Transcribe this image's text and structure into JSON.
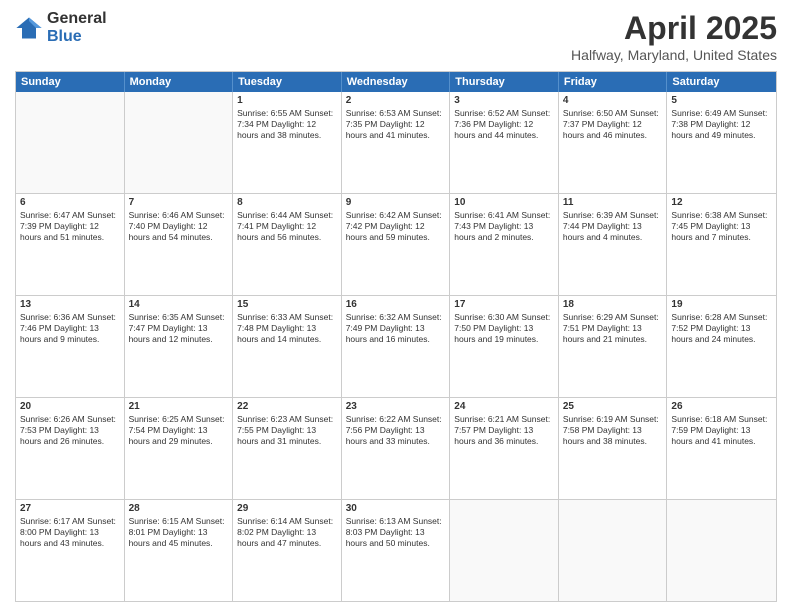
{
  "logo": {
    "general": "General",
    "blue": "Blue"
  },
  "title": {
    "month": "April 2025",
    "location": "Halfway, Maryland, United States"
  },
  "weekdays": [
    "Sunday",
    "Monday",
    "Tuesday",
    "Wednesday",
    "Thursday",
    "Friday",
    "Saturday"
  ],
  "weeks": [
    [
      {
        "day": "",
        "info": ""
      },
      {
        "day": "",
        "info": ""
      },
      {
        "day": "1",
        "info": "Sunrise: 6:55 AM\nSunset: 7:34 PM\nDaylight: 12 hours and 38 minutes."
      },
      {
        "day": "2",
        "info": "Sunrise: 6:53 AM\nSunset: 7:35 PM\nDaylight: 12 hours and 41 minutes."
      },
      {
        "day": "3",
        "info": "Sunrise: 6:52 AM\nSunset: 7:36 PM\nDaylight: 12 hours and 44 minutes."
      },
      {
        "day": "4",
        "info": "Sunrise: 6:50 AM\nSunset: 7:37 PM\nDaylight: 12 hours and 46 minutes."
      },
      {
        "day": "5",
        "info": "Sunrise: 6:49 AM\nSunset: 7:38 PM\nDaylight: 12 hours and 49 minutes."
      }
    ],
    [
      {
        "day": "6",
        "info": "Sunrise: 6:47 AM\nSunset: 7:39 PM\nDaylight: 12 hours and 51 minutes."
      },
      {
        "day": "7",
        "info": "Sunrise: 6:46 AM\nSunset: 7:40 PM\nDaylight: 12 hours and 54 minutes."
      },
      {
        "day": "8",
        "info": "Sunrise: 6:44 AM\nSunset: 7:41 PM\nDaylight: 12 hours and 56 minutes."
      },
      {
        "day": "9",
        "info": "Sunrise: 6:42 AM\nSunset: 7:42 PM\nDaylight: 12 hours and 59 minutes."
      },
      {
        "day": "10",
        "info": "Sunrise: 6:41 AM\nSunset: 7:43 PM\nDaylight: 13 hours and 2 minutes."
      },
      {
        "day": "11",
        "info": "Sunrise: 6:39 AM\nSunset: 7:44 PM\nDaylight: 13 hours and 4 minutes."
      },
      {
        "day": "12",
        "info": "Sunrise: 6:38 AM\nSunset: 7:45 PM\nDaylight: 13 hours and 7 minutes."
      }
    ],
    [
      {
        "day": "13",
        "info": "Sunrise: 6:36 AM\nSunset: 7:46 PM\nDaylight: 13 hours and 9 minutes."
      },
      {
        "day": "14",
        "info": "Sunrise: 6:35 AM\nSunset: 7:47 PM\nDaylight: 13 hours and 12 minutes."
      },
      {
        "day": "15",
        "info": "Sunrise: 6:33 AM\nSunset: 7:48 PM\nDaylight: 13 hours and 14 minutes."
      },
      {
        "day": "16",
        "info": "Sunrise: 6:32 AM\nSunset: 7:49 PM\nDaylight: 13 hours and 16 minutes."
      },
      {
        "day": "17",
        "info": "Sunrise: 6:30 AM\nSunset: 7:50 PM\nDaylight: 13 hours and 19 minutes."
      },
      {
        "day": "18",
        "info": "Sunrise: 6:29 AM\nSunset: 7:51 PM\nDaylight: 13 hours and 21 minutes."
      },
      {
        "day": "19",
        "info": "Sunrise: 6:28 AM\nSunset: 7:52 PM\nDaylight: 13 hours and 24 minutes."
      }
    ],
    [
      {
        "day": "20",
        "info": "Sunrise: 6:26 AM\nSunset: 7:53 PM\nDaylight: 13 hours and 26 minutes."
      },
      {
        "day": "21",
        "info": "Sunrise: 6:25 AM\nSunset: 7:54 PM\nDaylight: 13 hours and 29 minutes."
      },
      {
        "day": "22",
        "info": "Sunrise: 6:23 AM\nSunset: 7:55 PM\nDaylight: 13 hours and 31 minutes."
      },
      {
        "day": "23",
        "info": "Sunrise: 6:22 AM\nSunset: 7:56 PM\nDaylight: 13 hours and 33 minutes."
      },
      {
        "day": "24",
        "info": "Sunrise: 6:21 AM\nSunset: 7:57 PM\nDaylight: 13 hours and 36 minutes."
      },
      {
        "day": "25",
        "info": "Sunrise: 6:19 AM\nSunset: 7:58 PM\nDaylight: 13 hours and 38 minutes."
      },
      {
        "day": "26",
        "info": "Sunrise: 6:18 AM\nSunset: 7:59 PM\nDaylight: 13 hours and 41 minutes."
      }
    ],
    [
      {
        "day": "27",
        "info": "Sunrise: 6:17 AM\nSunset: 8:00 PM\nDaylight: 13 hours and 43 minutes."
      },
      {
        "day": "28",
        "info": "Sunrise: 6:15 AM\nSunset: 8:01 PM\nDaylight: 13 hours and 45 minutes."
      },
      {
        "day": "29",
        "info": "Sunrise: 6:14 AM\nSunset: 8:02 PM\nDaylight: 13 hours and 47 minutes."
      },
      {
        "day": "30",
        "info": "Sunrise: 6:13 AM\nSunset: 8:03 PM\nDaylight: 13 hours and 50 minutes."
      },
      {
        "day": "",
        "info": ""
      },
      {
        "day": "",
        "info": ""
      },
      {
        "day": "",
        "info": ""
      }
    ]
  ]
}
